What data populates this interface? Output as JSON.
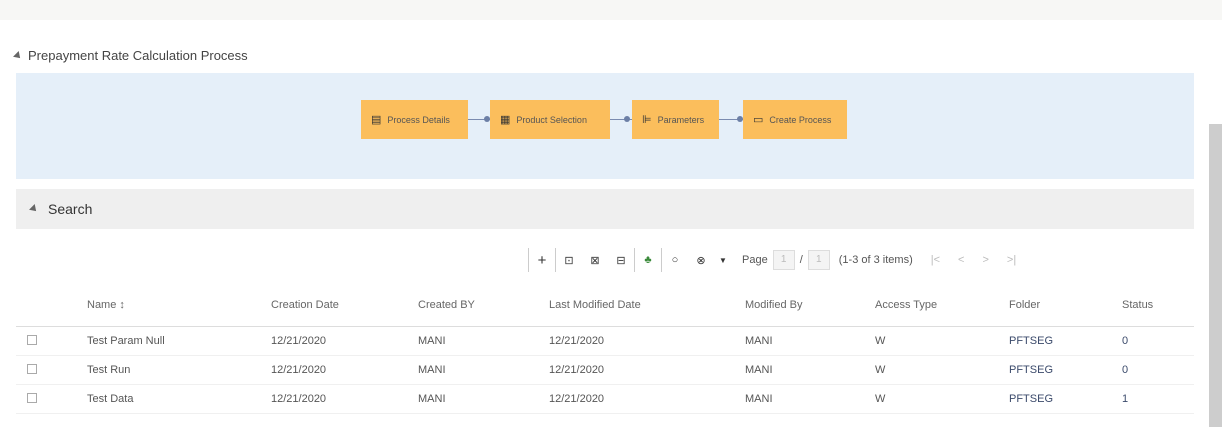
{
  "process": {
    "title": "Prepayment Rate Calculation Process",
    "nodes": [
      {
        "label": "Process Details",
        "icon": "document-icon"
      },
      {
        "label": "Product Selection",
        "icon": "product-icon"
      },
      {
        "label": "Parameters",
        "icon": "parameters-icon"
      },
      {
        "label": "Create Process",
        "icon": "folder-icon"
      }
    ]
  },
  "search": {
    "title": "Search"
  },
  "toolbar": {
    "add": "+",
    "b1": "⊡",
    "b2": "⊠",
    "b3": "⊟",
    "b4": "♣",
    "b5": "○",
    "b6": "⊗",
    "dropdown": "▼",
    "page_label": "Page",
    "page_value": "1",
    "slash": "/",
    "page_total": "1",
    "items": "(1-3 of 3 items)",
    "first": "|<",
    "prev": "<",
    "next": ">",
    "last": ">|"
  },
  "table": {
    "headers": [
      "",
      "Name ↕",
      "Creation Date",
      "Created BY",
      "Last Modified Date",
      "Modified By",
      "Access Type",
      "Folder",
      "Status"
    ],
    "rows": [
      {
        "name": "Test Param Null",
        "creation": "12/21/2020",
        "created_by": "MANI",
        "modified": "12/21/2020",
        "modified_by": "MANI",
        "access": "W",
        "folder": "PFTSEG",
        "status": "0"
      },
      {
        "name": "Test Run",
        "creation": "12/21/2020",
        "created_by": "MANI",
        "modified": "12/21/2020",
        "modified_by": "MANI",
        "access": "W",
        "folder": "PFTSEG",
        "status": "0"
      },
      {
        "name": "Test Data",
        "creation": "12/21/2020",
        "created_by": "MANI",
        "modified": "12/21/2020",
        "modified_by": "MANI",
        "access": "W",
        "folder": "PFTSEG",
        "status": "1"
      }
    ]
  },
  "colors": {
    "node": "#fbbe5c",
    "flow_bg": "#e5eff9",
    "search_bar": "#efefef",
    "connector": "#7a8bb0"
  }
}
